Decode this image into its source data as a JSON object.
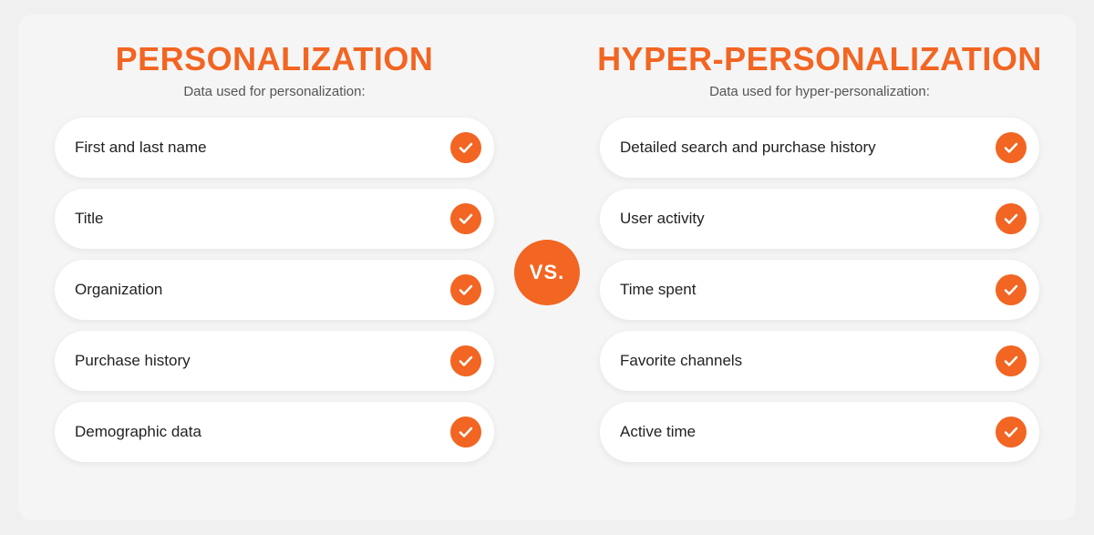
{
  "left": {
    "title": "PERSONALIZATION",
    "subtitle": "Data used for personalization:",
    "items": [
      "First and last name",
      "Title",
      "Organization",
      "Purchase history",
      "Demographic data"
    ]
  },
  "vs": {
    "label": "VS."
  },
  "right": {
    "title": "HYPER-PERSONALIZATION",
    "subtitle": "Data used for hyper-personalization:",
    "items": [
      "Detailed search and purchase history",
      "User activity",
      "Time spent",
      "Favorite channels",
      "Active time"
    ]
  }
}
